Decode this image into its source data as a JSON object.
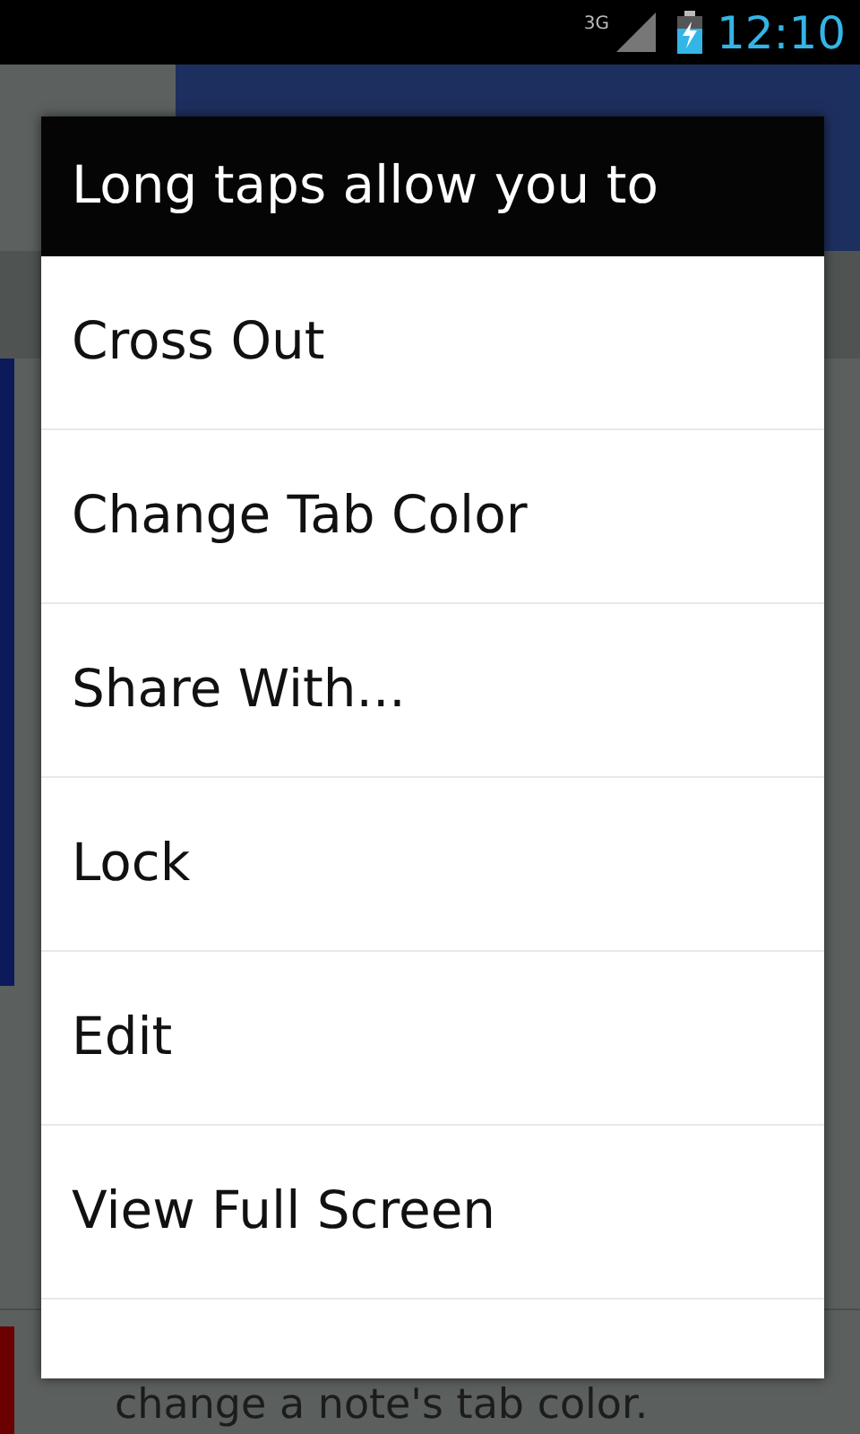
{
  "status_bar": {
    "network": "3G",
    "time": "12:10"
  },
  "background": {
    "hint": "change a note's tab color."
  },
  "dialog": {
    "title": "Long taps allow you to",
    "items": [
      {
        "label": "Cross Out"
      },
      {
        "label": "Change Tab Color"
      },
      {
        "label": "Share With..."
      },
      {
        "label": "Lock"
      },
      {
        "label": "Edit"
      },
      {
        "label": "View Full Screen"
      }
    ]
  }
}
